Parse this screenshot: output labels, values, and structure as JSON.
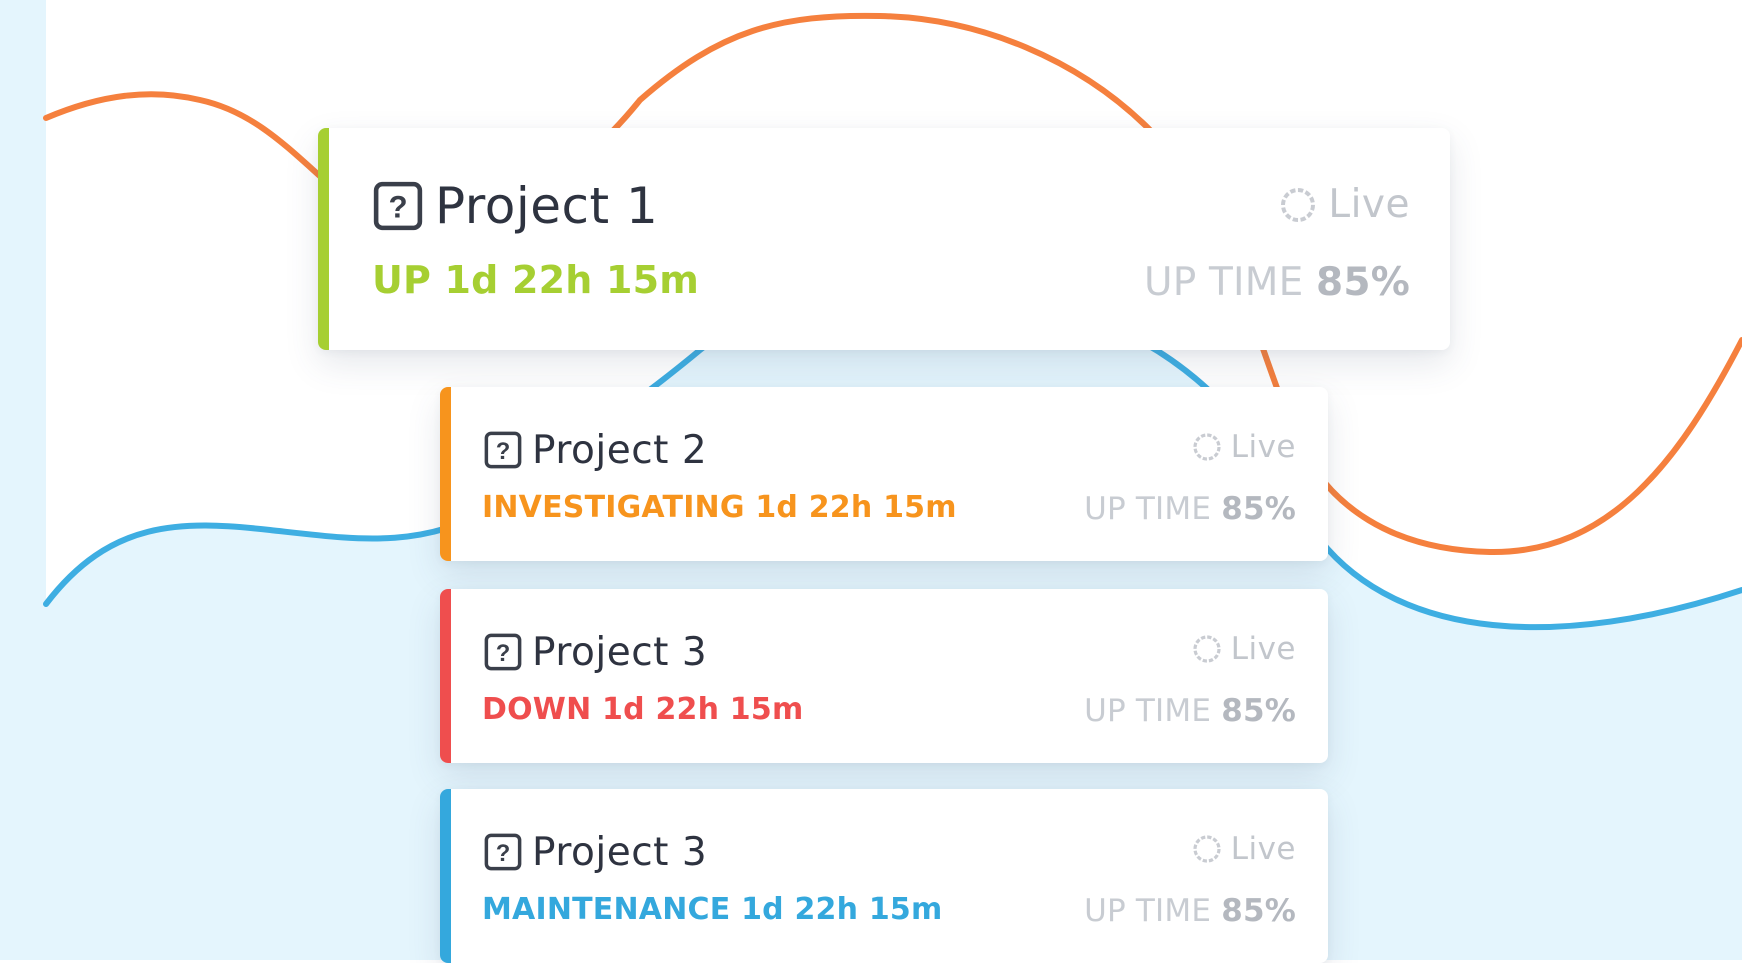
{
  "colors": {
    "background": "#ffffff",
    "left_strip": "#e4f5fd",
    "light_blue_fill": "#e4f5fd",
    "orange_wave": "#f5803e",
    "blue_wave": "#3eaee2",
    "status_up": "#a6cf32",
    "status_investigating": "#f7941d",
    "status_down": "#ef4e4e",
    "status_maintenance": "#34a8dd"
  },
  "projects": [
    {
      "icon": "help-icon",
      "title": "Project 1",
      "status_text": "UP 1d 22h 15m",
      "status_color": "#a6cf32",
      "live_icon": "live-icon",
      "live_label": "Live",
      "uptime_label": "UP TIME",
      "uptime_value": "85%"
    },
    {
      "icon": "help-icon",
      "title": "Project 2",
      "status_text": "INVESTIGATING  1d 22h 15m",
      "status_color": "#f7941d",
      "live_icon": "live-icon",
      "live_label": "Live",
      "uptime_label": "UP TIME",
      "uptime_value": "85%"
    },
    {
      "icon": "help-icon",
      "title": "Project 3",
      "status_text": "DOWN 1d 22h 15m",
      "status_color": "#ef4e4e",
      "live_icon": "live-icon",
      "live_label": "Live",
      "uptime_label": "UP TIME",
      "uptime_value": "85%"
    },
    {
      "icon": "help-icon",
      "title": "Project 3",
      "status_text": "MAINTENANCE 1d 22h 15m",
      "status_color": "#34a8dd",
      "live_icon": "live-icon",
      "live_label": "Live",
      "uptime_label": "UP TIME",
      "uptime_value": "85%"
    }
  ]
}
